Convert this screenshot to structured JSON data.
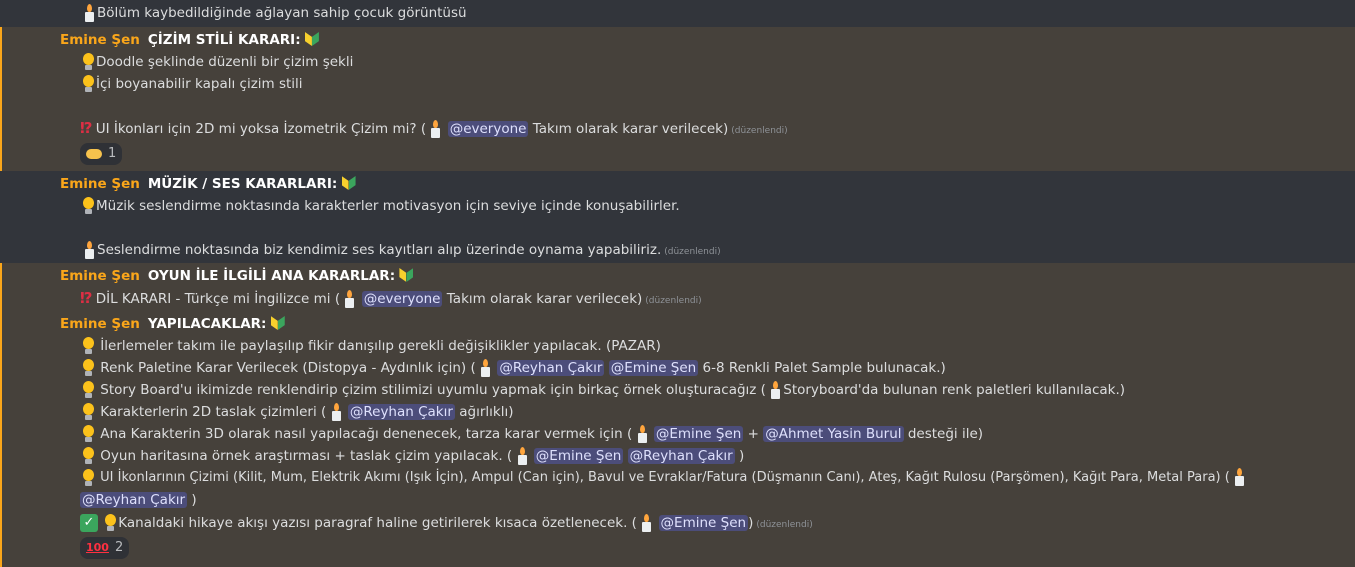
{
  "line0": "Bölüm kaybedildiğinde ağlayan sahip çocuk görüntüsü",
  "msg1": {
    "author": "Emine Şen",
    "title": "ÇİZİM STİLİ KARARI:",
    "l1": "Doodle şeklinde düzenli bir çizim şekli",
    "l2": "İçi boyanabilir kapalı çizim stili",
    "l3a": "UI İkonları için 2D mi yoksa İzometrik Çizim mi? (",
    "l3m": "@everyone",
    "l3b": "Takım olarak karar verilecek)",
    "edited": "(düzenlendi)",
    "reaction_count": "1"
  },
  "msg2": {
    "author": "Emine Şen",
    "title": "MÜZİK / SES KARARLARI:",
    "l1": "Müzik seslendirme noktasında karakterler motivasyon için seviye içinde konuşabilirler.",
    "l2": "Seslendirme noktasında biz kendimiz ses kayıtları alıp üzerinde oynama yapabiliriz.",
    "edited": "(düzenlendi)"
  },
  "msg3": {
    "author": "Emine Şen",
    "title": "OYUN İLE İLGİLİ ANA KARARLAR:",
    "l1a": "DİL KARARI - Türkçe mi İngilizce mi (",
    "l1m": "@everyone",
    "l1b": "Takım olarak karar verilecek)",
    "edited": "(düzenlendi)"
  },
  "msg4": {
    "author": "Emine Şen",
    "title": "YAPILACAKLAR:",
    "t1": "İlerlemeler takım ile paylaşılıp fikir danışılıp gerekli değişiklikler yapılacak. (PAZAR)",
    "t2a": "Renk Paletine Karar Verilecek (Distopya - Aydınlık için) (",
    "t2m1": "@Reyhan Çakır",
    "t2m2": "@Emine Şen",
    "t2b": "6-8 Renkli Palet Sample bulunacak.)",
    "t3a": "Story Board'u ikimizde renklendirip çizim stilimizi uyumlu yapmak için birkaç örnek oluşturacağız (",
    "t3b": "Storyboard'da bulunan renk paletleri kullanılacak.)",
    "t4a": "Karakterlerin 2D taslak çizimleri (",
    "t4m": "@Reyhan Çakır",
    "t4b": "ağırlıklı)",
    "t5a": "Ana Karakterin 3D olarak nasıl yapılacağı denenecek, tarza karar vermek için (",
    "t5m1": "@Emine Şen",
    "t5plus": "+",
    "t5m2": "@Ahmet Yasin Burul",
    "t5b": "desteği ile)",
    "t6a": "Oyun haritasına örnek araştırması + taslak çizim yapılacak. (",
    "t6m1": "@Emine Şen",
    "t6m2": "@Reyhan Çakır",
    "t6b": ")",
    "t7a": "UI İkonlarının Çizimi (Kilit, Mum, Elektrik Akımı (Işık İçin), Ampul (Can için), Bavul ve Evraklar/Fatura (Düşmanın Canı), Ateş, Kağıt Rulosu (Parşömen), Kağıt Para, Metal Para) (",
    "t7m": "@Reyhan Çakır",
    "t7b": ")",
    "t8a": "Kanaldaki hikaye akışı yazısı paragraf haline getirilerek kısaca özetlenecek. (",
    "t8m": "@Emine Şen",
    "t8b": ")",
    "edited": "(düzenlendi)",
    "reaction_count": "2",
    "reaction_label": "💯"
  }
}
